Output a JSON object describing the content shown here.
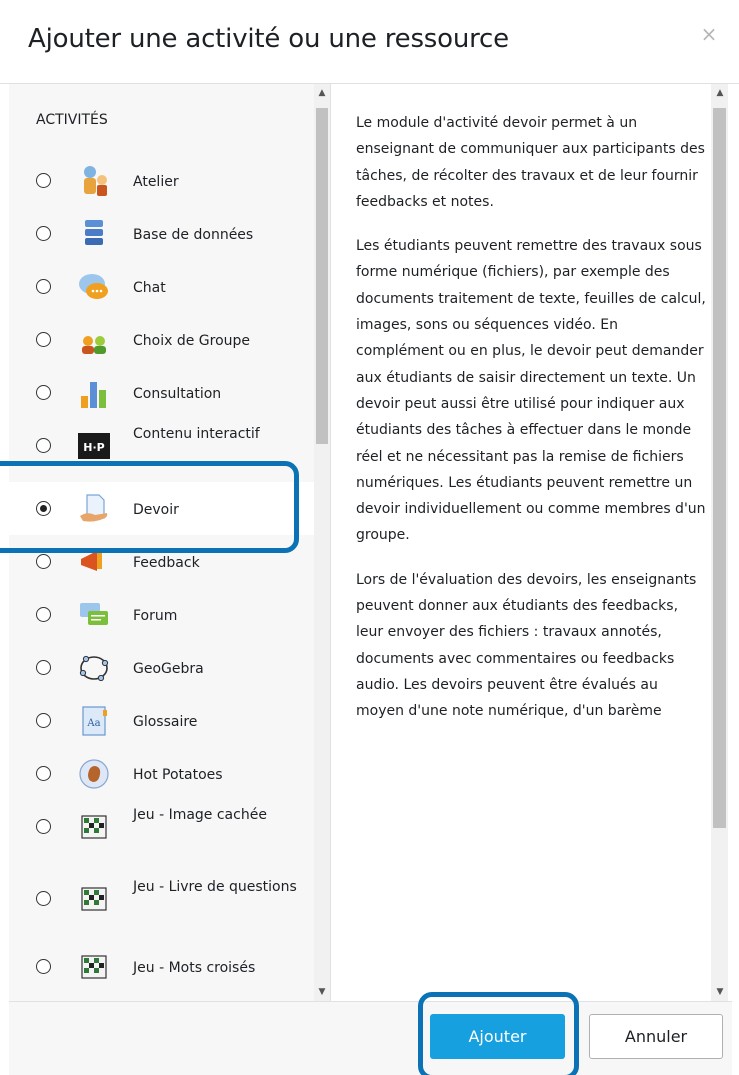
{
  "dialog": {
    "title": "Ajouter une activité ou une ressource",
    "close_symbol": "×"
  },
  "section_heading": "ACTIVITÉS",
  "options": [
    {
      "label": "Atelier",
      "icon": "workshop-icon",
      "selected": false
    },
    {
      "label": "Base de données",
      "icon": "database-icon",
      "selected": false
    },
    {
      "label": "Chat",
      "icon": "chat-icon",
      "selected": false
    },
    {
      "label": "Choix de Groupe",
      "icon": "group-choice-icon",
      "selected": false
    },
    {
      "label": "Consultation",
      "icon": "survey-icon",
      "selected": false
    },
    {
      "label": "Contenu interactif",
      "icon": "h5p-icon",
      "selected": false
    },
    {
      "label": "Devoir",
      "icon": "assignment-icon",
      "selected": true
    },
    {
      "label": "Feedback",
      "icon": "feedback-icon",
      "selected": false
    },
    {
      "label": "Forum",
      "icon": "forum-icon",
      "selected": false
    },
    {
      "label": "GeoGebra",
      "icon": "geogebra-icon",
      "selected": false
    },
    {
      "label": "Glossaire",
      "icon": "glossary-icon",
      "selected": false
    },
    {
      "label": "Hot Potatoes",
      "icon": "hot-potatoes-icon",
      "selected": false
    },
    {
      "label": "Jeu - Image cachée",
      "icon": "game-icon",
      "selected": false
    },
    {
      "label": "Jeu - Livre de questions",
      "icon": "game-icon",
      "selected": false
    },
    {
      "label": "Jeu - Mots croisés",
      "icon": "game-icon",
      "selected": false
    }
  ],
  "description": {
    "p1": "Le module d'activité devoir permet à un enseignant de communiquer aux participants des tâches, de récolter des travaux et de leur fournir feedbacks et notes.",
    "p2": "Les étudiants peuvent remettre des travaux sous forme numérique (fichiers), par exemple des documents traitement de texte, feuilles de calcul, images, sons ou séquences vidéo. En complément ou en plus, le devoir peut demander aux étudiants de saisir directement un texte. Un devoir peut aussi être utilisé pour indiquer aux étudiants des tâches à effectuer dans le monde réel et ne nécessitant pas la remise de fichiers numériques. Les étudiants peuvent remettre un devoir individuellement ou comme membres d'un groupe.",
    "p3": "Lors de l'évaluation des devoirs, les enseignants peuvent donner aux étudiants des feedbacks, leur envoyer des fichiers : travaux annotés, documents avec commentaires ou feedbacks audio. Les devoirs peuvent être évalués au moyen d'une note numérique, d'un barème"
  },
  "buttons": {
    "add": "Ajouter",
    "cancel": "Annuler"
  },
  "colors": {
    "primary": "#16a0e0",
    "highlight": "#0b72b5"
  }
}
